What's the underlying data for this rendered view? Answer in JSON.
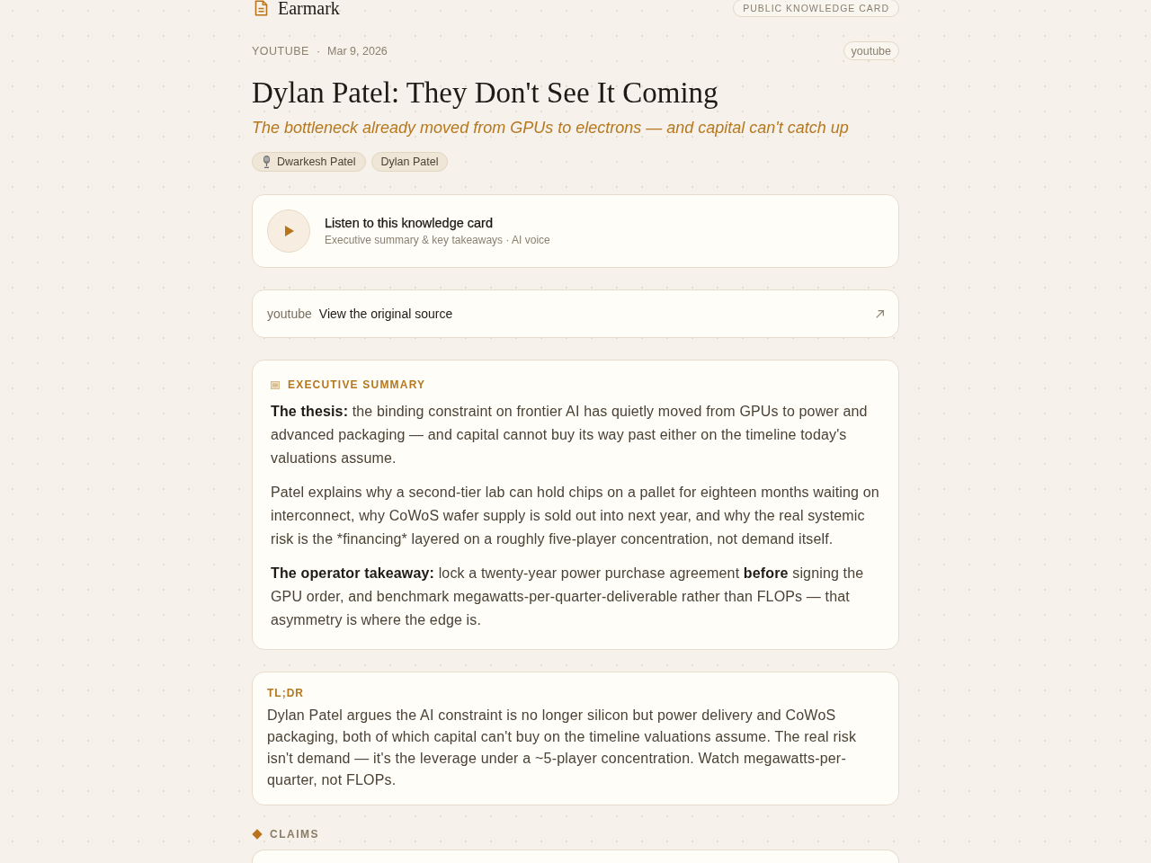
{
  "header": {
    "brand": "Earmark",
    "badge": "PUBLIC KNOWLEDGE CARD"
  },
  "meta": {
    "source": "YOUTUBE",
    "separator": "·",
    "date": "Mar 9, 2026",
    "tag": "youtube"
  },
  "title": "Dylan Patel: They Don't See It Coming",
  "subtitle": "The bottleneck already moved from GPUs to electrons — and capital can't catch up",
  "people": [
    {
      "name": "Dwarkesh Patel",
      "kind": "host"
    },
    {
      "name": "Dylan Patel",
      "kind": "guest"
    }
  ],
  "audio": {
    "title": "Listen to this knowledge card",
    "subtitle": "Executive summary & key takeaways · AI voice"
  },
  "source_link": {
    "platform": "youtube",
    "label": "View the original source"
  },
  "executive_summary": {
    "heading": "EXECUTIVE SUMMARY",
    "paragraphs": [
      {
        "runs": [
          {
            "text": "The thesis:",
            "bold": true
          },
          {
            "text": " the binding constraint on frontier AI has quietly moved from GPUs to power and advanced packaging — and capital cannot buy its way past either on the timeline today's valuations assume.",
            "bold": false
          }
        ]
      },
      {
        "runs": [
          {
            "text": "Patel explains why a second-tier lab can hold chips on a pallet for eighteen months waiting on interconnect, why CoWoS wafer supply is sold out into next year, and why the real systemic risk is the *financing* layered on a roughly five-player concentration, not demand itself.",
            "bold": false
          }
        ]
      },
      {
        "runs": [
          {
            "text": "The operator takeaway:",
            "bold": true
          },
          {
            "text": " lock a twenty-year power purchase agreement ",
            "bold": false
          },
          {
            "text": "before",
            "bold": true
          },
          {
            "text": " signing the GPU order, and benchmark megawatts-per-quarter-deliverable rather than FLOPs — that asymmetry is where the edge is.",
            "bold": false
          }
        ]
      }
    ]
  },
  "tldr": {
    "label": "TL;DR",
    "text": "Dylan Patel argues the AI constraint is no longer silicon but power delivery and CoWoS packaging, both of which capital can't buy on the timeline valuations assume. The real risk isn't demand — it's the leverage under a ~5-player concentration. Watch megawatts-per-quarter, not FLOPs."
  },
  "claims": {
    "heading": "CLAIMS"
  }
}
